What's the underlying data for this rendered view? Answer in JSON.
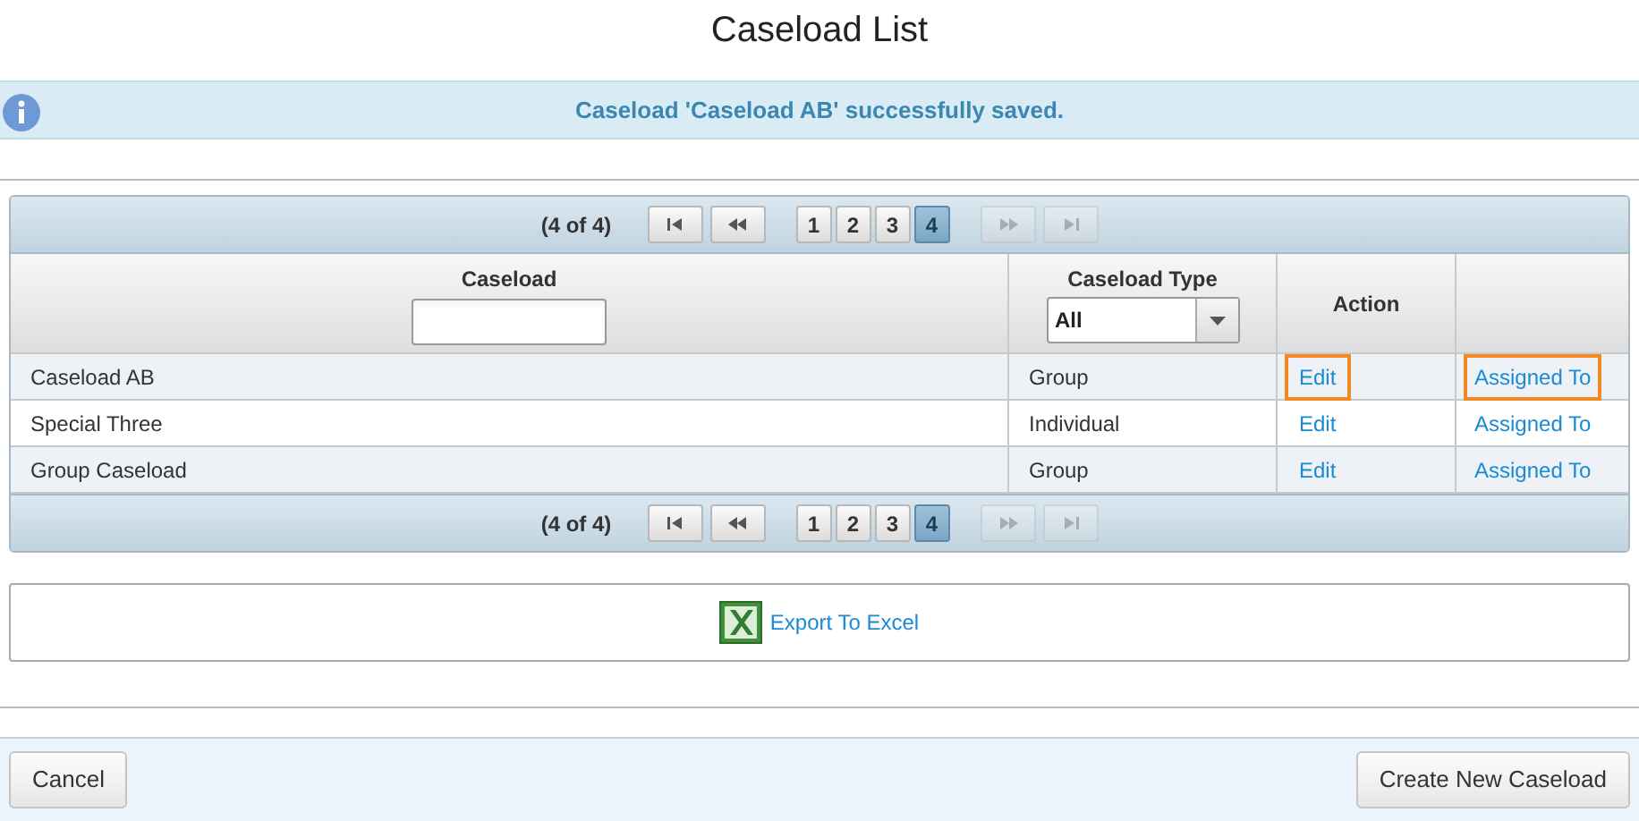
{
  "title": "Caseload List",
  "message": {
    "text": "Caseload 'Caseload AB' successfully saved."
  },
  "pagers": [
    {
      "summary": "(4 of 4)",
      "nav_before": [
        {
          "kind": "first",
          "disabled": false
        },
        {
          "kind": "prev",
          "disabled": false
        }
      ],
      "pages": [
        {
          "label": "1",
          "selected": false
        },
        {
          "label": "2",
          "selected": false
        },
        {
          "label": "3",
          "selected": false
        },
        {
          "label": "4",
          "selected": true
        }
      ],
      "nav_after": [
        {
          "kind": "next",
          "disabled": true
        },
        {
          "kind": "last",
          "disabled": true
        }
      ]
    },
    {
      "summary": "(4 of 4)",
      "nav_before": [
        {
          "kind": "first",
          "disabled": false
        },
        {
          "kind": "prev",
          "disabled": false
        }
      ],
      "pages": [
        {
          "label": "1",
          "selected": false
        },
        {
          "label": "2",
          "selected": false
        },
        {
          "label": "3",
          "selected": false
        },
        {
          "label": "4",
          "selected": true
        }
      ],
      "nav_after": [
        {
          "kind": "next",
          "disabled": true
        },
        {
          "kind": "last",
          "disabled": true
        }
      ]
    }
  ],
  "table": {
    "columns": [
      {
        "label": "Caseload",
        "kind": "text"
      },
      {
        "label": "Caseload Type",
        "kind": "select",
        "filter_value": "All"
      },
      {
        "label": "Action",
        "kind": "plain"
      },
      {
        "kind": "blank"
      }
    ],
    "rows": [
      {
        "caseload": "Caseload AB",
        "type": "Group",
        "edit": "Edit",
        "assigned": "Assigned To",
        "highlighted": true
      },
      {
        "caseload": "Special Three",
        "type": "Individual",
        "edit": "Edit",
        "assigned": "Assigned To",
        "highlighted": false
      },
      {
        "caseload": "Group Caseload",
        "type": "Group",
        "edit": "Edit",
        "assigned": "Assigned To",
        "highlighted": false
      }
    ]
  },
  "export": {
    "label": "Export To Excel"
  },
  "buttons": {
    "cancel": "Cancel",
    "create": "Create New Caseload"
  }
}
